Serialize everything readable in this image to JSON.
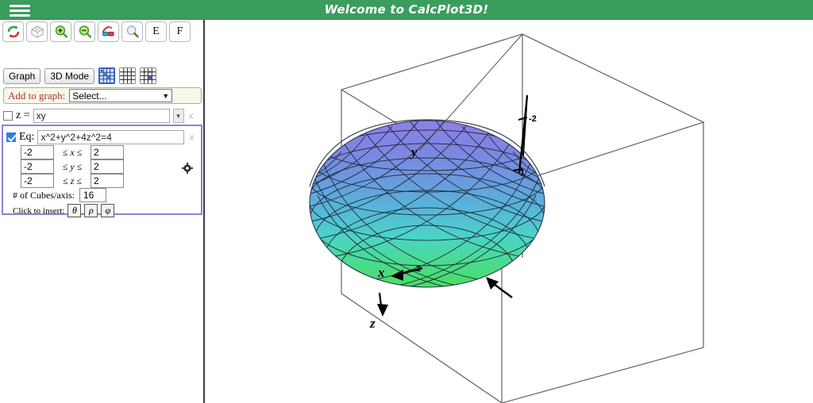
{
  "window": {
    "title": "Welcome to CalcPlot3D!",
    "menu_icon": "hamburger-icon",
    "title_bar_color": "#3a9d5d"
  },
  "toolbar": {
    "buttons": [
      {
        "name": "rotate-reset-icon",
        "label": ""
      },
      {
        "name": "wireframe-icon",
        "label": ""
      },
      {
        "name": "zoom-in-icon",
        "label": ""
      },
      {
        "name": "zoom-out-icon",
        "label": ""
      },
      {
        "name": "anaglyph-glasses-icon",
        "label": ""
      },
      {
        "name": "magnifier-icon",
        "label": ""
      },
      {
        "name": "e-button",
        "label": "E"
      },
      {
        "name": "f-button",
        "label": "F"
      }
    ]
  },
  "mode_bar": {
    "graph_label": "Graph",
    "mode_label": "3D Mode",
    "icons": [
      {
        "name": "contour-grid-icon",
        "selected": true
      },
      {
        "name": "grid-plain-icon",
        "selected": false
      },
      {
        "name": "grid-point-icon",
        "selected": false
      }
    ]
  },
  "add_to_graph": {
    "label": "Add to graph:",
    "selected": "Select...",
    "placeholder": "Select...",
    "accent_color": "#b03030"
  },
  "functions": [
    {
      "id": "f1",
      "checked": false,
      "label": "z =",
      "value": "xy",
      "has_dropdown": true,
      "close_label": "x"
    },
    {
      "id": "f2",
      "checked": true,
      "label": "Eq:",
      "value": "x^2+y^2+4z^2=4",
      "has_dropdown": false,
      "close_label": "x"
    }
  ],
  "bounds": [
    {
      "min": "-2",
      "var": "x",
      "max": "2",
      "op_left": "≤",
      "op_right": "≤"
    },
    {
      "min": "-2",
      "var": "y",
      "max": "2",
      "op_left": "≤",
      "op_right": "≤"
    },
    {
      "min": "-2",
      "var": "z",
      "max": "2",
      "op_left": "≤",
      "op_right": "≤"
    }
  ],
  "cubes": {
    "label": "# of Cubes/axis:",
    "value": "16"
  },
  "insert": {
    "label": "Click to insert:",
    "symbols": [
      "θ",
      "ρ",
      "φ"
    ]
  },
  "settings_icon": "gear-icon",
  "plot": {
    "equation": "x^2+y^2+4z^2=4",
    "surface_type": "ellipsoid",
    "axis_labels": {
      "x": "x",
      "y": "y",
      "z": "z"
    },
    "tick_labels": [
      {
        "axis": "y",
        "text": "-2"
      },
      {
        "axis": "y",
        "text": "1"
      },
      {
        "axis": "x",
        "text": "2"
      }
    ],
    "colors": {
      "top": "#8b7fe2",
      "upper_mid": "#6d95dd",
      "mid": "#5bc0d8",
      "lower_mid": "#4dd6bf",
      "bottom": "#49dd66",
      "wireframe": "#1d2a3a",
      "box": "#555555"
    }
  }
}
